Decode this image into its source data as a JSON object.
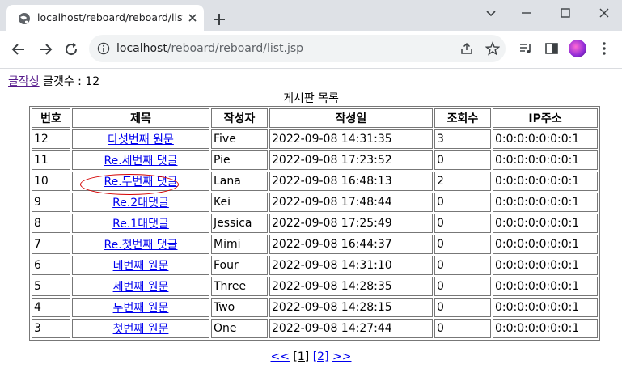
{
  "browser": {
    "tab_title": "localhost/reboard/reboard/list.jsp",
    "url_host": "localhost",
    "url_path": "/reboard/reboard/list.jsp"
  },
  "page": {
    "write_link": "글작성",
    "count_label": "글갯수 : 12",
    "caption": "게시판 목록",
    "headers": {
      "no": "번호",
      "title": "제목",
      "writer": "작성자",
      "date": "작성일",
      "views": "조회수",
      "ip": "IP주소"
    },
    "rows": [
      {
        "no": "12",
        "title": "다섯번째 원문",
        "writer": "Five",
        "date": "2022-09-08 14:31:35",
        "views": "3",
        "ip": "0:0:0:0:0:0:0:1",
        "depth": 0
      },
      {
        "no": "11",
        "title": "Re.세번째 댓글",
        "writer": "Pie",
        "date": "2022-09-08 17:23:52",
        "views": "0",
        "ip": "0:0:0:0:0:0:0:1",
        "depth": 1
      },
      {
        "no": "10",
        "title": "Re.두번째 댓글",
        "writer": "Lana",
        "date": "2022-09-08 16:48:13",
        "views": "2",
        "ip": "0:0:0:0:0:0:0:1",
        "depth": 1
      },
      {
        "no": "9",
        "title": "Re.2대댓글",
        "writer": "Kei",
        "date": "2022-09-08 17:48:44",
        "views": "0",
        "ip": "0:0:0:0:0:0:0:1",
        "depth": 2
      },
      {
        "no": "8",
        "title": "Re.1대댓글",
        "writer": "Jessica",
        "date": "2022-09-08 17:25:49",
        "views": "0",
        "ip": "0:0:0:0:0:0:0:1",
        "depth": 2
      },
      {
        "no": "7",
        "title": "Re.첫번째 댓글",
        "writer": "Mimi",
        "date": "2022-09-08 16:44:37",
        "views": "0",
        "ip": "0:0:0:0:0:0:0:1",
        "depth": 1
      },
      {
        "no": "6",
        "title": "네번째 원문",
        "writer": "Four",
        "date": "2022-09-08 14:31:10",
        "views": "0",
        "ip": "0:0:0:0:0:0:0:1",
        "depth": 0
      },
      {
        "no": "5",
        "title": "세번째 원문",
        "writer": "Three",
        "date": "2022-09-08 14:28:35",
        "views": "0",
        "ip": "0:0:0:0:0:0:0:1",
        "depth": 0
      },
      {
        "no": "4",
        "title": "두번째 원문",
        "writer": "Two",
        "date": "2022-09-08 14:28:15",
        "views": "0",
        "ip": "0:0:0:0:0:0:0:1",
        "depth": 0
      },
      {
        "no": "3",
        "title": "첫번째 원문",
        "writer": "One",
        "date": "2022-09-08 14:27:44",
        "views": "0",
        "ip": "0:0:0:0:0:0:0:1",
        "depth": 0
      }
    ],
    "pager": {
      "prev": "<<",
      "pages": [
        "[1]",
        "[2]"
      ],
      "next": ">>"
    }
  },
  "colors": {
    "annotation": "#d40000",
    "link": "#0000ee",
    "visited": "#551a8b"
  }
}
